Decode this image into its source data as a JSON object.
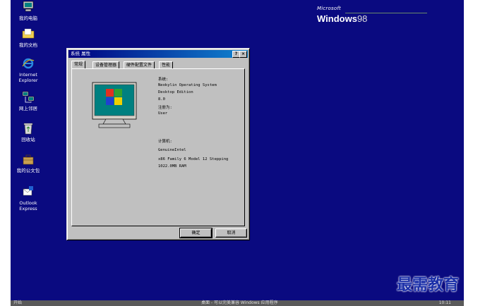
{
  "desktop": {
    "icons": [
      {
        "label": "我的电脑",
        "icon": "computer-icon"
      },
      {
        "label": "我的文档",
        "icon": "folder-icon"
      },
      {
        "label": "Internet Explorer",
        "icon": "ie-icon"
      },
      {
        "label": "网上邻居",
        "icon": "network-icon"
      },
      {
        "label": "回收站",
        "icon": "recycle-bin-icon"
      },
      {
        "label": "我的公文包",
        "icon": "briefcase-icon"
      },
      {
        "label": "Outlook Express",
        "icon": "outlook-icon"
      }
    ],
    "logo": {
      "brand": "Microsoft",
      "product": "Windows",
      "version": "98"
    }
  },
  "dialog": {
    "title": "系统 属性",
    "help_label": "?",
    "close_label": "×",
    "tabs": [
      "常规",
      "设备管理器",
      "硬件配置文件",
      "性能"
    ],
    "system_heading": "系统:",
    "os_name": "Neokylin Operating System",
    "edition": "Desktop Edition",
    "version": "8.0",
    "registered_heading": "注册为:",
    "registered_user": "User",
    "computer_heading": "计算机:",
    "cpu_vendor": "GenuineIntel",
    "cpu_model": "x86 Family 6 Model 12 Stepping",
    "memory": "1022.0MB RAM",
    "ok_label": "确定",
    "cancel_label": "取消"
  },
  "taskbar": {
    "start_label": "开始",
    "center_text": "桌面 - 可以完美兼容 Windows 应用程序",
    "tray_text": "10:11"
  },
  "watermark": "最需教育",
  "colors": {
    "desktop": "#0a0a80",
    "titlebar": "#000080",
    "face": "#c0c0c0",
    "watermark": "#1a2ea8"
  }
}
